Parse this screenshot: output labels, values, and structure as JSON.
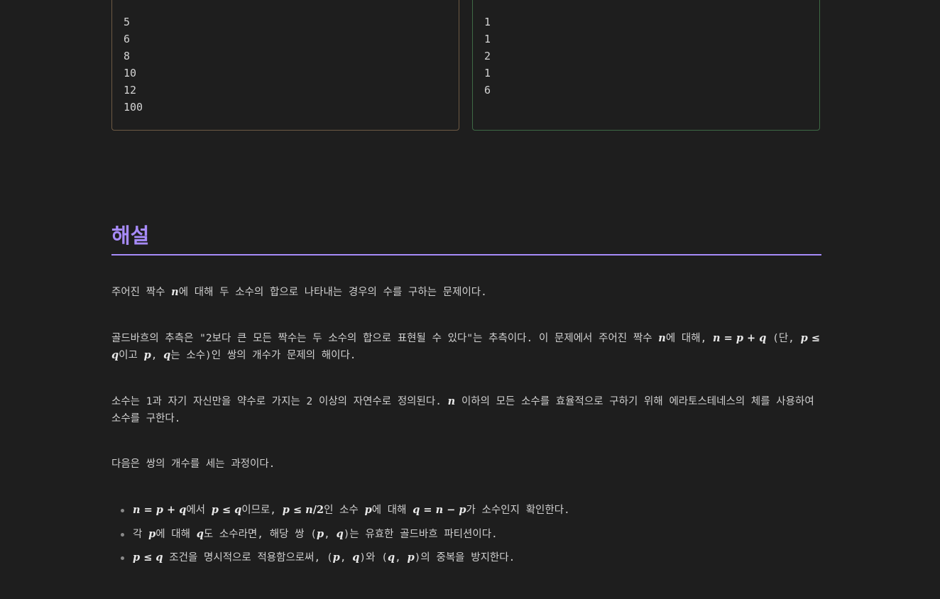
{
  "input_lines": [
    "5",
    "6",
    "8",
    "10",
    "12",
    "100"
  ],
  "output_lines": [
    "1",
    "1",
    "2",
    "1",
    "6"
  ],
  "solution": {
    "heading": "해설",
    "p1": [
      "주어진 짝수 ",
      "n",
      "에 대해 두 소수의 합으로 나타내는 경우의 수를 구하는 문제이다."
    ],
    "p2": [
      "골드바흐의 추측은 \"2보다 큰 모든 짝수는 두 소수의 합으로 표현될 수 있다\"는 추측이다. 이 문제에서 주어진 짝수 ",
      "n",
      "에 대해, ",
      "n",
      " = ",
      "p",
      " + ",
      "q",
      " (단, ",
      "p",
      " ≤ ",
      "q",
      "이고 ",
      "p",
      ", ",
      "q",
      "는 소수)인 쌍의 개수가 문제의 해이다."
    ],
    "p3": [
      "소수는 1과 자기 자신만을 약수로 가지는 2 이상의 자연수로 정의된다. ",
      "n",
      " 이하의 모든 소수를 효율적으로 구하기 위해 에라토스테네스의 체를 사용하여 소수를 구한다."
    ],
    "p4": "다음은 쌍의 개수를 세는 과정이다.",
    "bullets": [
      [
        "n",
        " = ",
        "p",
        " + ",
        "q",
        "에서 ",
        "p",
        " ≤ ",
        "q",
        "이므로, ",
        "p",
        " ≤ ",
        "n",
        "/",
        "2",
        "인 소수 ",
        "p",
        "에 대해 ",
        "q",
        " = ",
        "n",
        " − ",
        "p",
        "가 소수인지 확인한다."
      ],
      [
        "각 ",
        "p",
        "에 대해 ",
        "q",
        "도 소수라면, 해당 쌍 (",
        "p",
        ", ",
        "q",
        ")는 유효한 골드바흐 파티션이다."
      ],
      [
        "p",
        " ≤ ",
        "q",
        " 조건을 명시적으로 적용함으로써, (",
        "p",
        ", ",
        "q",
        ")와 (",
        "q",
        ", ",
        "p",
        ")의 중복을 방지한다."
      ]
    ]
  }
}
